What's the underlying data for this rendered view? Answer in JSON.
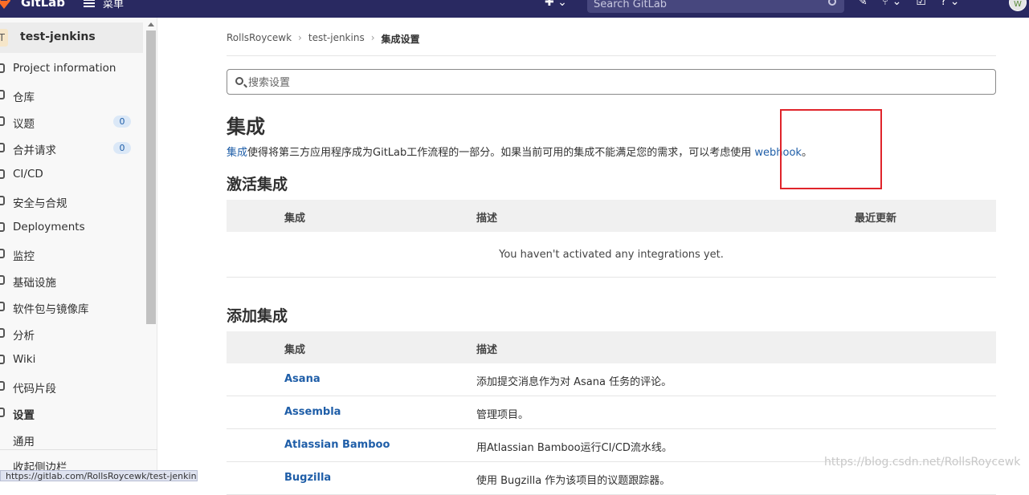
{
  "topbar": {
    "brand": "GitLab",
    "menu_label": "菜单",
    "search_placeholder": "Search GitLab",
    "colors": {
      "navbar": "#292961",
      "accent": "#1f5ea8"
    }
  },
  "sidebar": {
    "project_initial": "T",
    "project_name": "test-jenkins",
    "items": [
      {
        "label": "Project information",
        "icon": "info-icon"
      },
      {
        "label": "仓库",
        "icon": "book-icon"
      },
      {
        "label": "议题",
        "icon": "issues-icon",
        "badge": "0"
      },
      {
        "label": "合并请求",
        "icon": "merge-request-icon",
        "badge": "0"
      },
      {
        "label": "CI/CD",
        "icon": "rocket-icon"
      },
      {
        "label": "安全与合规",
        "icon": "shield-icon"
      },
      {
        "label": "Deployments",
        "icon": "deployments-icon"
      },
      {
        "label": "监控",
        "icon": "monitor-icon"
      },
      {
        "label": "基础设施",
        "icon": "cloud-icon"
      },
      {
        "label": "软件包与镜像库",
        "icon": "package-icon"
      },
      {
        "label": "分析",
        "icon": "chart-icon"
      },
      {
        "label": "Wiki",
        "icon": "wiki-icon"
      },
      {
        "label": "代码片段",
        "icon": "snippet-icon"
      },
      {
        "label": "设置",
        "icon": "settings-icon"
      },
      {
        "label": "通用",
        "icon": ""
      }
    ],
    "collapse_label": "收起侧边栏"
  },
  "status_url": "https://gitlab.com/RollsRoycewk/test-jenkins",
  "breadcrumb": {
    "items": [
      "RollsRoycewk",
      "test-jenkins",
      "集成设置"
    ]
  },
  "settings_search": {
    "placeholder": "搜索设置"
  },
  "page": {
    "title": "集成",
    "intro_link": "集成",
    "intro_text": "使得将第三方应用程序成为GitLab工作流程的一部分。如果当前可用的集成不能满足您的需求，可以考虑使用 ",
    "intro_webhook": "webhook",
    "intro_end": "。"
  },
  "active": {
    "heading": "激活集成",
    "columns": {
      "integration": "集成",
      "description": "描述",
      "updated": "最近更新"
    },
    "empty": "You haven't activated any integrations yet."
  },
  "add": {
    "heading": "添加集成",
    "columns": {
      "integration": "集成",
      "description": "描述"
    },
    "rows": [
      {
        "name": "Asana",
        "desc": "添加提交消息作为对 Asana 任务的评论。"
      },
      {
        "name": "Assembla",
        "desc": "管理项目。"
      },
      {
        "name": "Atlassian Bamboo",
        "desc": "用Atlassian Bamboo运行CI/CD流水线。"
      },
      {
        "name": "Bugzilla",
        "desc": "使用 Bugzilla 作为该项目的议题跟踪器。"
      }
    ]
  },
  "watermark": "https://blog.csdn.net/RollsRoycewk"
}
